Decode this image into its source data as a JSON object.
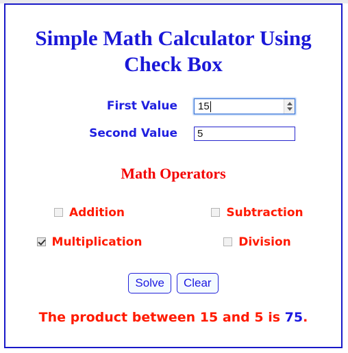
{
  "page": {
    "title": "Simple Math Calculator Using Check Box",
    "title_line1": "Simple Math Calculator Using",
    "title_line2": "Check Box",
    "title_color": "#1a18d8",
    "frame_border_color": "#1818c8",
    "accent_red": "#ff1a00",
    "accent_blue": "#1a18e0"
  },
  "fields": {
    "first": {
      "label": "First Value",
      "value": "15",
      "placeholder": "",
      "type": "number",
      "focused": true
    },
    "second": {
      "label": "Second Value",
      "value": "5",
      "placeholder": "",
      "type": "text",
      "focused": false
    }
  },
  "operators": {
    "heading": "Math Operators",
    "items": [
      {
        "label": "Addition",
        "checked": false
      },
      {
        "label": "Subtraction",
        "checked": false
      },
      {
        "label": "Multiplication",
        "checked": true
      },
      {
        "label": "Division",
        "checked": false
      }
    ]
  },
  "buttons": {
    "solve": "Solve",
    "clear": "Clear"
  },
  "result": {
    "prefix": "The product between 15 and 5 is ",
    "answer": "75",
    "suffix": "."
  }
}
